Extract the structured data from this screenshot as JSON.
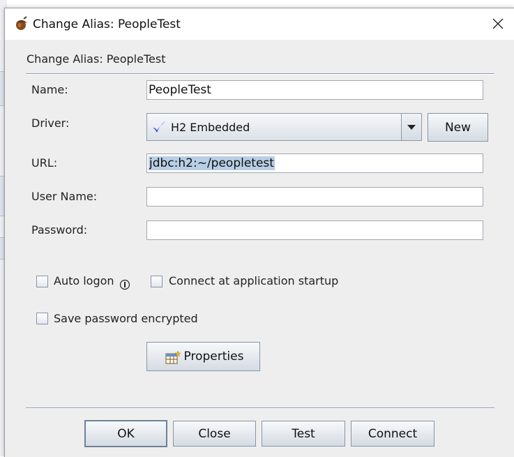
{
  "window": {
    "title": "Change Alias: PeopleTest",
    "icon": "acorn-icon",
    "close_icon": "close-icon"
  },
  "header": {
    "title": "Change Alias: PeopleTest"
  },
  "form": {
    "name": {
      "label": "Name:",
      "value": "PeopleTest"
    },
    "driver": {
      "label": "Driver:",
      "value": "H2 Embedded",
      "icon": "checkmark-icon",
      "new_label": "New"
    },
    "url": {
      "label": "URL:",
      "value": "jdbc:h2:~/peopletest",
      "selected": true
    },
    "user_name": {
      "label": "User Name:",
      "value": ""
    },
    "password": {
      "label": "Password:",
      "value": ""
    }
  },
  "options": {
    "auto_logon": {
      "label": "Auto logon",
      "checked": false,
      "info_icon": "info-icon"
    },
    "connect_at_startup": {
      "label": "Connect at application startup",
      "checked": false
    },
    "save_password_encrypted": {
      "label": "Save password encrypted",
      "checked": false
    }
  },
  "properties_button": {
    "label": "Properties",
    "icon": "properties-table-icon"
  },
  "footer": {
    "ok_label": "OK",
    "close_label": "Close",
    "test_label": "Test",
    "connect_label": "Connect"
  },
  "colors": {
    "dialog_bg": "#eeeeee",
    "separator": "#8e9cba",
    "selection": "#b8cfe5",
    "check_blue": "#1a3fd6"
  }
}
